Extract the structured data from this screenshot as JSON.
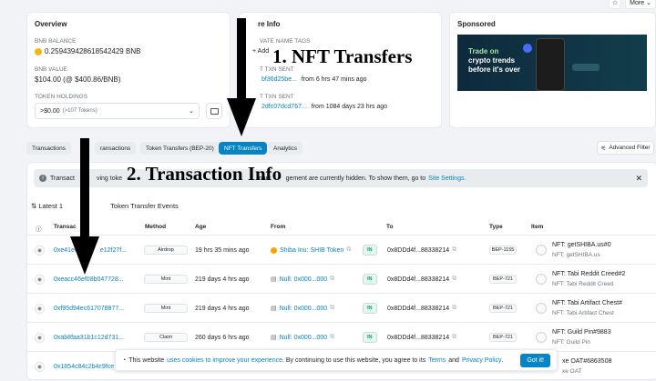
{
  "top_buttons": {
    "star": "☆",
    "more": "More ⌄"
  },
  "overview": {
    "title": "Overview",
    "bnb_balance_label": "BNB BALANCE",
    "bnb_balance": "0.259439428618542429 BNB",
    "bnb_value_label": "BNB VALUE",
    "bnb_value": "$104.00 (@ $400.86/BNB)",
    "token_holdings_label": "TOKEN HOLDINGS",
    "token_holdings_value": ">$0.00",
    "token_holdings_count": "(>107 Tokens)"
  },
  "more_info": {
    "title": "re Info",
    "private_tags_label": "VATE NAME TAGS",
    "add_label": "+ Add",
    "first_txn_label": "T TXN SENT",
    "first_txn_hash": "bf36d25be...",
    "first_txn_time": "from 6 hrs 47 mins ago",
    "last_txn_label": "T TXN SENT",
    "last_txn_hash": "2dfc07dcd767...",
    "last_txn_time": "from 1084 days 23 hrs ago"
  },
  "sponsored": {
    "title": "Sponsored",
    "ad_line1": "Trade on",
    "ad_line2": "crypto trends",
    "ad_line3": "before it's over"
  },
  "tabs": [
    {
      "label": "Transactions"
    },
    {
      "label": "ransactions"
    },
    {
      "label": "Token Transfers (BEP-20)"
    },
    {
      "label": "NFT Transfers"
    },
    {
      "label": "Analytics"
    }
  ],
  "advanced_filter": "Advanced Filter",
  "notice": {
    "text_a": "Transact",
    "text_b": "ving toke",
    "text_c": "mark",
    "text_d": "gement are currently hidden. To show them, go to",
    "link": "Site Settings."
  },
  "latest": {
    "prefix": "⇅ Latest 1",
    "suffix": "Token Transfer Events"
  },
  "headers": {
    "txn": "Transac",
    "method": "Method",
    "age": "Age",
    "from": "From",
    "to": "To",
    "type": "Type",
    "item": "Item"
  },
  "rows": [
    {
      "hash": "0xe41e6",
      "hash_tail": "e12f27f...",
      "method": "Airdrop",
      "age": "19 hrs 35 mins ago",
      "from": "Shiba Inu: SHIB Token",
      "dir": "IN",
      "to": "0x8DDd4f...88338214",
      "type": "BEP-1155",
      "item": "NFT: getSHIBA.us#0",
      "item_sub": "NFT: getSHIBA.us"
    },
    {
      "hash": "0xeacc46ef08b047728...",
      "hash_tail": "",
      "method": "Mint",
      "age": "219 days 4 hrs ago",
      "from": "Null: 0x000...000",
      "dir": "IN",
      "to": "0x8DDd4f...88338214",
      "type": "BEP-721",
      "item": "NFT: Tabi Reddit Creed#2",
      "item_sub": "NFT: Tabi Reddit Creed"
    },
    {
      "hash": "0xf95d94ec617078877...",
      "hash_tail": "",
      "method": "Mint",
      "age": "219 days 4 hrs ago",
      "from": "Null: 0x000...000",
      "dir": "IN",
      "to": "0x8DDd4f...88338214",
      "type": "BEP-721",
      "item": "NFT: Tabi Artifact Chest#",
      "item_sub": "NFT: Tabi Artifact Chest"
    },
    {
      "hash": "0xab8faa31b1c12d731...",
      "hash_tail": "",
      "method": "Claim",
      "age": "260 days 6 hrs ago",
      "from": "Null: 0x000...000",
      "dir": "IN",
      "to": "0x8DDd4f...88338214",
      "type": "BEP-721",
      "item": "NFT: Guild Pin#9883",
      "item_sub": "NFT: Guild Pin"
    },
    {
      "hash": "0x1854c84c2b4c9fce",
      "hash_tail": "",
      "method": "",
      "age": "",
      "from": "",
      "dir": "",
      "to": "",
      "type": "",
      "item": "xe OAT#6863508",
      "item_sub": "xe OAT"
    }
  ],
  "cookie": {
    "text_a": "This website",
    "link1": "uses cookies to improve your experience",
    "text_b": ". By continuing to use this website, you agree to its",
    "link2": "Terms",
    "text_c": "and",
    "link3": "Privacy Policy",
    "text_d": ".",
    "button": "Got it!"
  },
  "annotations": {
    "a1": "1. NFT Transfers",
    "a2": "2. Transaction Info"
  }
}
